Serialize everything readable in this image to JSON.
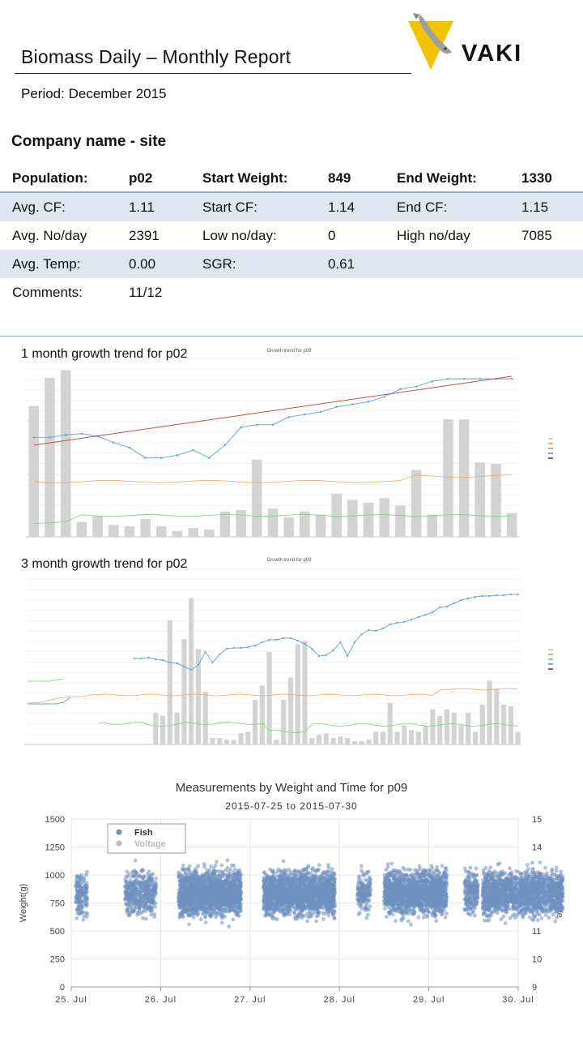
{
  "header": {
    "title": "Biomass Daily – Monthly Report",
    "period": "Period: December 2015",
    "logo_text": "VAKI"
  },
  "company": "Company name - site",
  "info": {
    "population_label": "Population:",
    "population": "p02",
    "start_weight_label": "Start Weight:",
    "start_weight": "849",
    "end_weight_label": "End Weight:",
    "end_weight": "1330",
    "avg_cf_label": "Avg. CF:",
    "avg_cf": "1.11",
    "start_cf_label": "Start CF:",
    "start_cf": "1.14",
    "end_cf_label": "End CF:",
    "end_cf": "1.15",
    "avg_no_label": "Avg. No/day",
    "avg_no": "2391",
    "low_no_label": "Low no/day:",
    "low_no": "0",
    "high_no_label": "High no/day",
    "high_no": "7085",
    "avg_temp_label": "Avg. Temp:",
    "avg_temp": "0.00",
    "sgr_label": "SGR:",
    "sgr": "0.61",
    "comments_label": "Comments:",
    "comments": "11/12"
  },
  "trend1": {
    "label": "1 month growth trend for p02",
    "inner_title": "Growth trend for p09"
  },
  "trend3": {
    "label": "3 month growth trend for p02",
    "inner_title": "Growth trend for p09"
  },
  "colors": {
    "bar": "#d3d3d3",
    "weight": "#6fa8dc",
    "trend": "#c0504d",
    "temp": "#f4a460",
    "cf": "#7fd07f",
    "scatter": "#6f8fbf"
  },
  "chart_data": [
    {
      "type": "bar",
      "title": "Growth trend for p09",
      "series_bars": [
        88,
        107,
        112,
        10,
        14,
        8,
        7,
        12,
        7,
        4,
        6,
        5,
        17,
        18,
        52,
        19,
        13,
        17,
        15,
        29,
        25,
        23,
        26,
        21,
        45,
        15,
        79,
        79,
        50,
        49,
        16
      ],
      "series_weight": [
        790,
        790,
        800,
        805,
        795,
        770,
        750,
        710,
        710,
        720,
        740,
        710,
        760,
        830,
        840,
        840,
        870,
        880,
        890,
        910,
        920,
        930,
        950,
        980,
        990,
        1010,
        1020,
        1020,
        1020,
        1020,
        1020
      ],
      "series_trend_start": 760,
      "series_trend_end": 1030
    },
    {
      "type": "bar",
      "title": "Growth trend for p09",
      "series_bars": [
        0,
        0,
        0,
        0,
        0,
        0,
        0,
        0,
        0,
        0,
        0,
        0,
        0,
        0,
        0,
        0,
        0,
        0,
        20,
        18,
        78,
        20,
        66,
        92,
        60,
        33,
        4,
        4,
        3,
        3,
        7,
        8,
        28,
        37,
        58,
        3,
        28,
        42,
        63,
        65,
        4,
        6,
        7,
        4,
        5,
        4,
        2,
        2,
        3,
        8,
        8,
        26,
        8,
        12,
        9,
        8,
        12,
        22,
        18,
        22,
        20,
        12,
        20,
        8,
        25,
        40,
        35,
        25,
        24,
        8
      ],
      "series_weight": [
        null,
        null,
        null,
        null,
        null,
        null,
        null,
        null,
        null,
        null,
        null,
        null,
        null,
        null,
        null,
        null,
        null,
        null,
        null,
        null,
        null,
        null,
        null,
        null,
        null,
        null,
        null,
        null,
        null,
        null,
        null,
        null,
        null,
        null,
        null,
        null,
        null,
        null,
        null,
        null,
        null,
        null,
        null,
        null,
        null,
        null,
        null,
        null,
        null,
        null,
        null,
        null,
        null,
        null,
        null,
        null,
        null,
        null,
        null,
        null,
        null,
        null,
        null,
        null,
        null,
        null,
        null,
        null,
        null,
        null
      ]
    },
    {
      "type": "scatter",
      "title": "Measurements by Weight and Time for p09",
      "subtitle": "2015-07-25 to 2015-07-30",
      "ylabel": "Weight(g)",
      "y2label": "Voltage",
      "ylim": [
        0,
        1500
      ],
      "y2lim": [
        9,
        15
      ],
      "yticks": [
        0,
        250,
        500,
        750,
        1000,
        1250,
        1500
      ],
      "y2ticks": [
        9,
        10,
        11,
        12,
        13,
        14,
        15
      ],
      "xticks": [
        "25. Jul",
        "26. Jul",
        "27. Jul",
        "28. Jul",
        "29. Jul",
        "30. Jul"
      ],
      "legend": [
        "Fish",
        "Voltage"
      ],
      "legend_position": "top-left"
    }
  ]
}
